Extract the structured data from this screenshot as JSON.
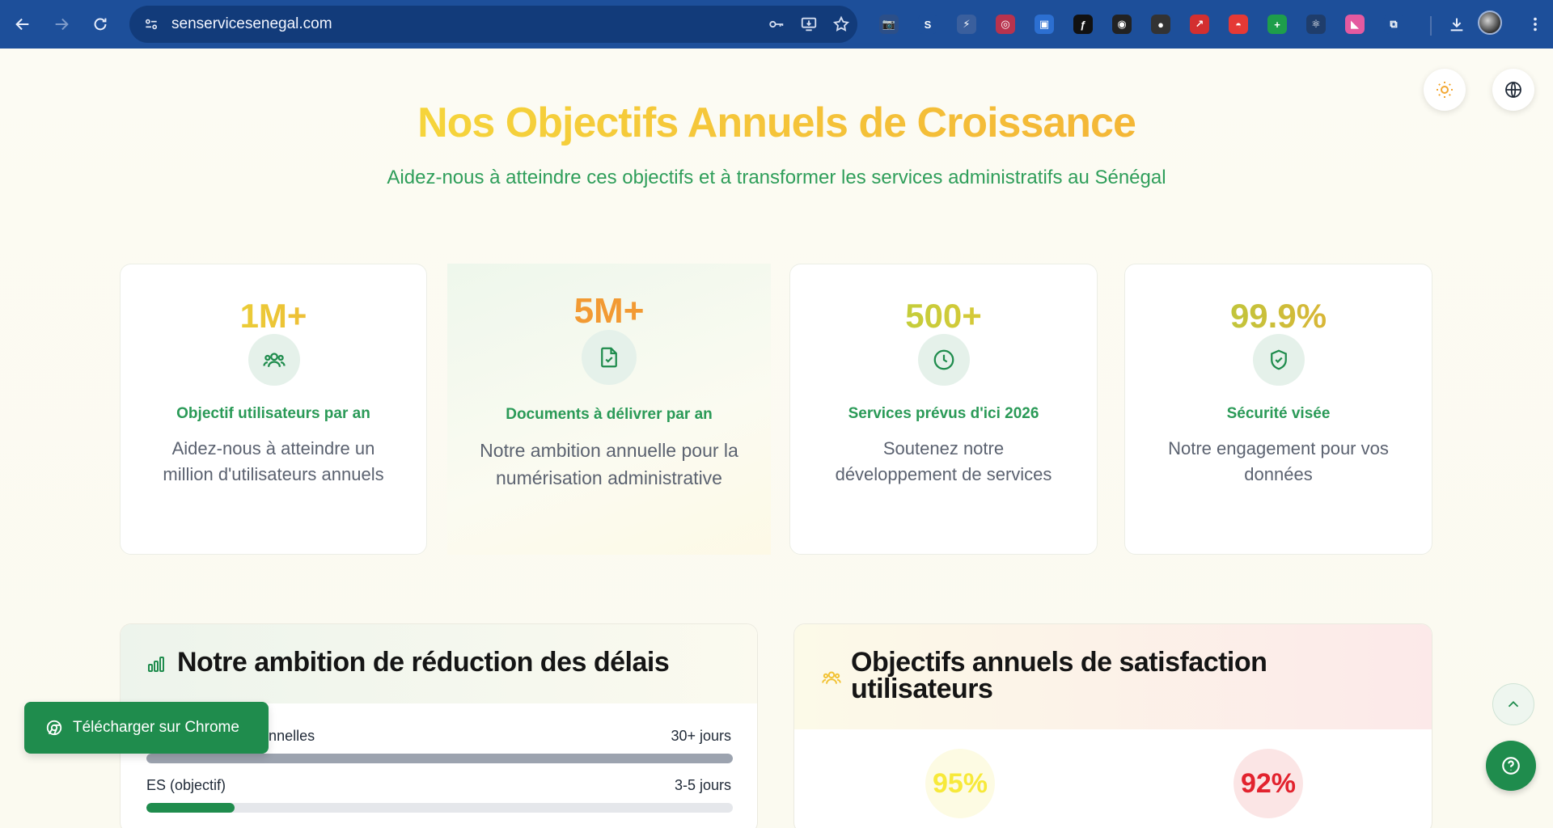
{
  "browser": {
    "url": "senservicesenegal.com",
    "extensions": [
      {
        "name": "camera-extension-icon",
        "glyph": "📷",
        "color": "#2c4f88"
      },
      {
        "name": "s-extension-icon",
        "glyph": "S",
        "color": "#1d4f9a"
      },
      {
        "name": "bolt-extension-icon",
        "glyph": "⚡",
        "color": "#3a5f9d"
      },
      {
        "name": "target-extension-icon",
        "glyph": "◎",
        "color": "#b8334e"
      },
      {
        "name": "screen-extension-icon",
        "glyph": "▣",
        "color": "#2c6fd1"
      },
      {
        "name": "formula-extension-icon",
        "glyph": "ƒ",
        "color": "#111111"
      },
      {
        "name": "eye-extension-icon",
        "glyph": "◉",
        "color": "#222222"
      },
      {
        "name": "dark-circle-extension-icon",
        "glyph": "●",
        "color": "#333333"
      },
      {
        "name": "arrow-extension-icon",
        "glyph": "↗",
        "color": "#d32f2f"
      },
      {
        "name": "pokeball-extension-icon",
        "glyph": "◓",
        "color": "#e53935"
      },
      {
        "name": "plus-extension-icon",
        "glyph": "+",
        "color": "#1e9e4b"
      },
      {
        "name": "react-extension-icon",
        "glyph": "⚛",
        "color": "#1f3d6b"
      },
      {
        "name": "flag-extension-icon",
        "glyph": "◣",
        "color": "#e45aa0"
      },
      {
        "name": "puzzle-extension-icon",
        "glyph": "⧉",
        "color": "#1d4f9a"
      }
    ]
  },
  "hero": {
    "title": "Nos Objectifs Annuels de Croissance",
    "subtitle": "Aidez-nous à atteindre ces objectifs et à transformer les services administratifs au Sénégal"
  },
  "stats": [
    {
      "value": "1M+",
      "title": "Objectif utilisateurs par an",
      "desc": "Aidez-nous à atteindre un million d'utilisateurs annuels",
      "icon": "users-icon"
    },
    {
      "value": "5M+",
      "title": "Documents à délivrer par an",
      "desc": "Notre ambition annuelle pour la numérisation administrative",
      "icon": "document-check-icon"
    },
    {
      "value": "500+",
      "title": "Services prévus d'ici 2026",
      "desc": "Soutenez notre développement de services",
      "icon": "clock-icon"
    },
    {
      "value": "99.9%",
      "title": "Sécurité visée",
      "desc": "Notre engagement pour vos données",
      "icon": "shield-check-icon"
    }
  ],
  "delays_panel": {
    "title": "Notre ambition de réduction des délais",
    "rows": [
      {
        "label": "Démarches traditionnelles",
        "value": "30+ jours",
        "fill": 1.0,
        "color": "#9ca3af"
      },
      {
        "label": "ES (objectif)",
        "value": "3-5 jours",
        "fill": 0.15,
        "color": "#1f8c4d"
      }
    ]
  },
  "satisfaction_panel": {
    "title_line1": "Objectifs annuels de satisfaction",
    "title_line2": "utilisateurs",
    "metrics": [
      {
        "value": "95%",
        "color": "#f7e93a",
        "bg": "#fdfbe3"
      },
      {
        "value": "92%",
        "color": "#e2232e",
        "bg": "#fbe5e5"
      }
    ]
  },
  "cta": {
    "chrome_label": "Télécharger sur Chrome"
  }
}
